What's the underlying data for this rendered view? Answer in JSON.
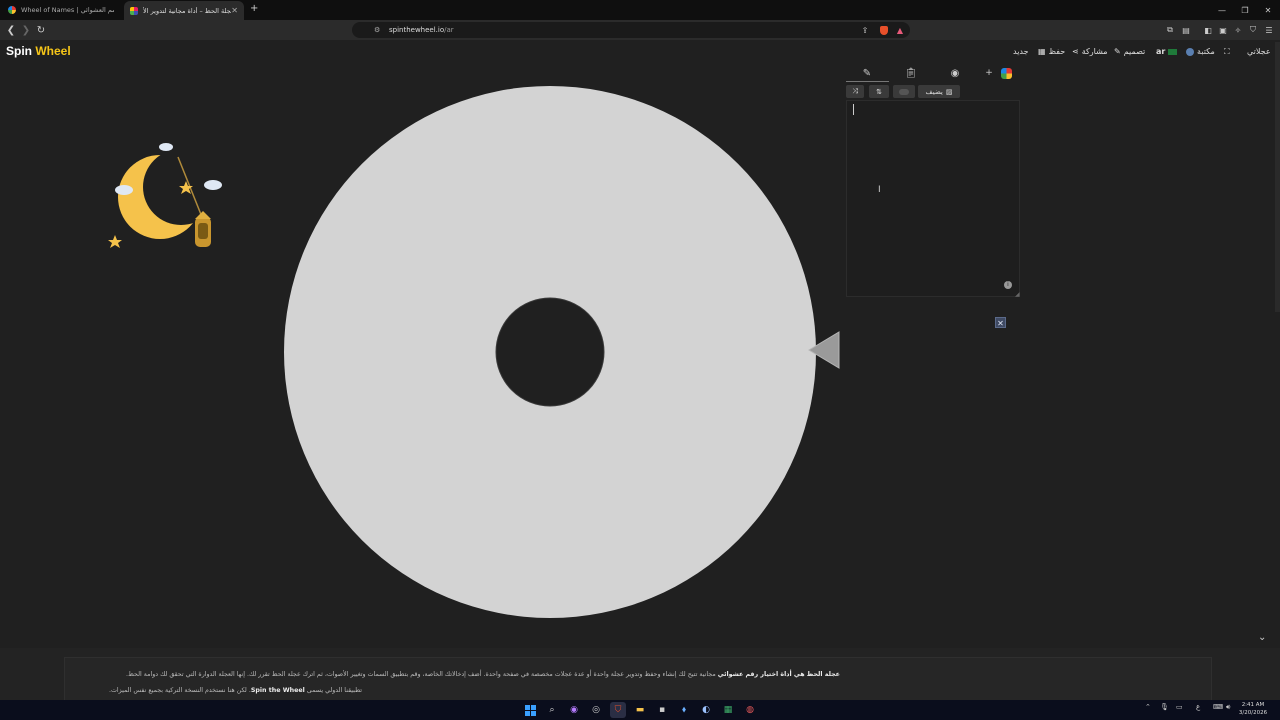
{
  "browser": {
    "tabs": [
      {
        "title": "Wheel of Names | تدوير الاسم العشوائي",
        "active": false
      },
      {
        "title": "عجلة الحظ – أداة مجانية لتدوير الأ",
        "active": true
      }
    ],
    "new_tab": "+",
    "url_host": "spinthewheel.io",
    "url_path": "/ar"
  },
  "app": {
    "logo_spin": "Spin",
    "logo_wheel": "Wheel",
    "menu": {
      "my_wheels": "عجلاتي",
      "library": "مكتبة",
      "language": "ar",
      "design": "تصميم",
      "share": "مشاركة",
      "save": "حفظ",
      "new": "جديد"
    }
  },
  "panel": {
    "add_image_label": "يضيف",
    "entries_text": ""
  },
  "colors": {
    "wheel": "#d3d3d3",
    "background": "#202020",
    "accent": "#f5c518"
  },
  "description": {
    "line1_bold": "عجلة الحظ هي أداة اختيار رقم عشوائي",
    "line1_rest": " مجانية تتيح لك إنشاء وحفظ وتدوير عجلة واحدة أو عدة عجلات مخصصة في صفحة واحدة. أضف إدخالاتك الخاصة، وقم بتطبيق السمات وتغيير الأصوات، ثم اترك عجلة الحظ تقرر لك. إنها العجلة الدوارة التي تحقق لك دوامة الحظ.",
    "line2_start": "تطبيقنا الدولي يسمى ",
    "line2_bold": "Spin the Wheel",
    "line2_rest": ". لكن هنا نستخدم النسخة التركية بجميع نفس الميزات."
  },
  "taskbar": {
    "time": "2:41 AM",
    "date": "3/20/2026",
    "lang": "ع"
  }
}
